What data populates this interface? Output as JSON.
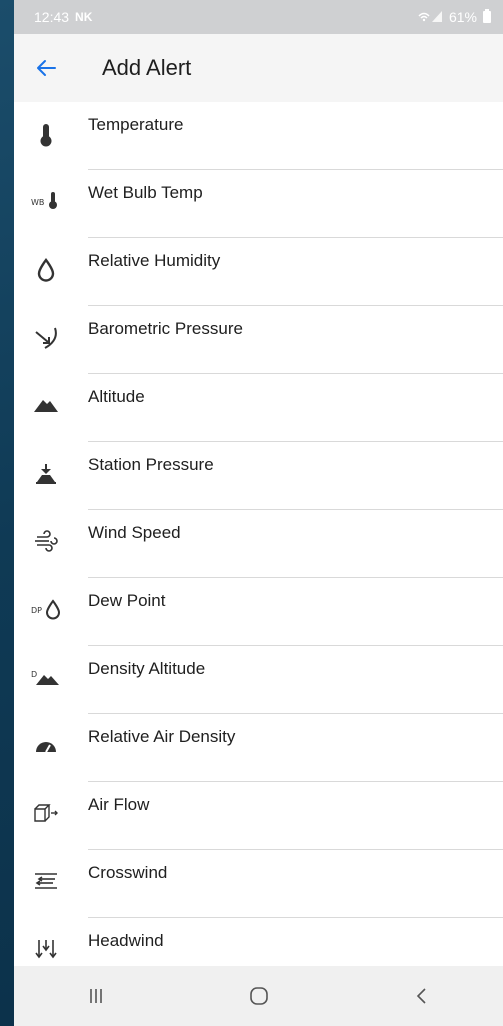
{
  "status_bar": {
    "time": "12:43",
    "carrier": "NK",
    "battery": "61%"
  },
  "app_bar": {
    "title": "Add Alert",
    "back_icon": "arrow-left-icon"
  },
  "colors": {
    "accent": "#1a73e8",
    "status_bar_bg": "#cfd0d2",
    "app_bar_bg": "#f5f5f5",
    "icon": "#333333",
    "divider": "#d9d9d9"
  },
  "items": [
    {
      "label": "Temperature",
      "icon": "thermometer-icon"
    },
    {
      "label": "Wet Bulb Temp",
      "icon": "wet-bulb-icon"
    },
    {
      "label": "Relative Humidity",
      "icon": "droplet-icon"
    },
    {
      "label": "Barometric Pressure",
      "icon": "barometer-icon"
    },
    {
      "label": "Altitude",
      "icon": "mountain-icon"
    },
    {
      "label": "Station Pressure",
      "icon": "station-pressure-icon"
    },
    {
      "label": "Wind Speed",
      "icon": "wind-icon"
    },
    {
      "label": "Dew Point",
      "icon": "dew-point-icon"
    },
    {
      "label": "Density Altitude",
      "icon": "density-altitude-icon"
    },
    {
      "label": "Relative Air Density",
      "icon": "air-density-gauge-icon"
    },
    {
      "label": "Air Flow",
      "icon": "air-flow-icon"
    },
    {
      "label": "Crosswind",
      "icon": "crosswind-icon"
    },
    {
      "label": "Headwind",
      "icon": "headwind-icon"
    }
  ],
  "nav_bar": {
    "recents_icon": "recents-icon",
    "home_icon": "home-icon",
    "back_icon": "nav-back-icon"
  }
}
